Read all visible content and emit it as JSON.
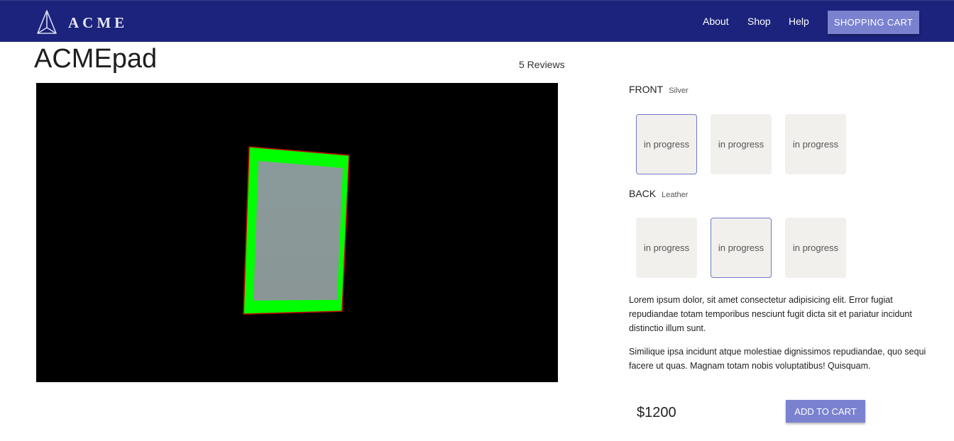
{
  "nav": {
    "brand": "ACME",
    "links": [
      "About",
      "Shop",
      "Help"
    ],
    "cart_label": "SHOPPING CART"
  },
  "product": {
    "title": "ACMEpad",
    "reviews": "5 Reviews",
    "front": {
      "label": "FRONT",
      "selected_name": "Silver",
      "options": [
        "in progress",
        "in progress",
        "in progress"
      ],
      "selected_index": 0
    },
    "back": {
      "label": "BACK",
      "selected_name": "Leather",
      "options": [
        "in progress",
        "in progress",
        "in progress"
      ],
      "selected_index": 1
    },
    "description": [
      "Lorem ipsum dolor, sit amet consectetur adipisicing elit. Error fugiat repudiandae totam temporibus nesciunt fugit dicta sit et pariatur incidunt distinctio illum sunt.",
      "Similique ipsa incidunt atque molestiae dignissimos repudiandae, quo sequi facere ut quas. Magnam totam nobis voluptatibus! Quisquam."
    ],
    "price": "$1200",
    "add_label": "ADD TO CART"
  },
  "colors": {
    "navbar": "#1b237c",
    "accent": "#7a82d0",
    "viewer_bg": "#000000",
    "device_frame": "#00ff00",
    "device_screen": "#8a9a9a"
  }
}
